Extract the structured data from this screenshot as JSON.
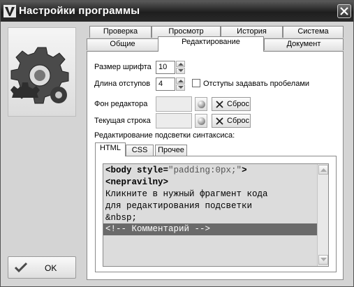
{
  "window": {
    "title": "Настройки программы"
  },
  "tabs_row1": [
    "Проверка",
    "Просмотр",
    "История",
    "Система"
  ],
  "tabs_row2": [
    "Общие",
    "Редактирование",
    "Документ"
  ],
  "editing": {
    "font_size_label": "Размер шрифта",
    "font_size_value": "10",
    "indent_label": "Длина отступов",
    "indent_value": "4",
    "spaces_checkbox_label": "Отступы задавать пробелами",
    "bg_label": "Фон редактора",
    "current_line_label": "Текущая строка",
    "reset_label": "Сброс",
    "syntax_label": "Редактирование подсветки синтаксиса:"
  },
  "syntax_tabs": [
    "HTML",
    "CSS",
    "Прочее"
  ],
  "code": {
    "line1_tag": "<body",
    "line1_attr": " style=",
    "line1_val": "\"padding:0px;\"",
    "line1_end": ">",
    "line2": "<nepravilny>",
    "line3": "Кликните в нужный фрагмент кода",
    "line4": "для редактирования подсветки",
    "line5": "&nbsp;",
    "line6": "<!-- Комментарий -->"
  },
  "ok_label": "OK",
  "colors": {
    "titlebar": "#2a2a2a",
    "window_bg": "#d4d4d4",
    "editor_bg": "#dcdcdc",
    "selected_line": "#6a6a6a"
  }
}
